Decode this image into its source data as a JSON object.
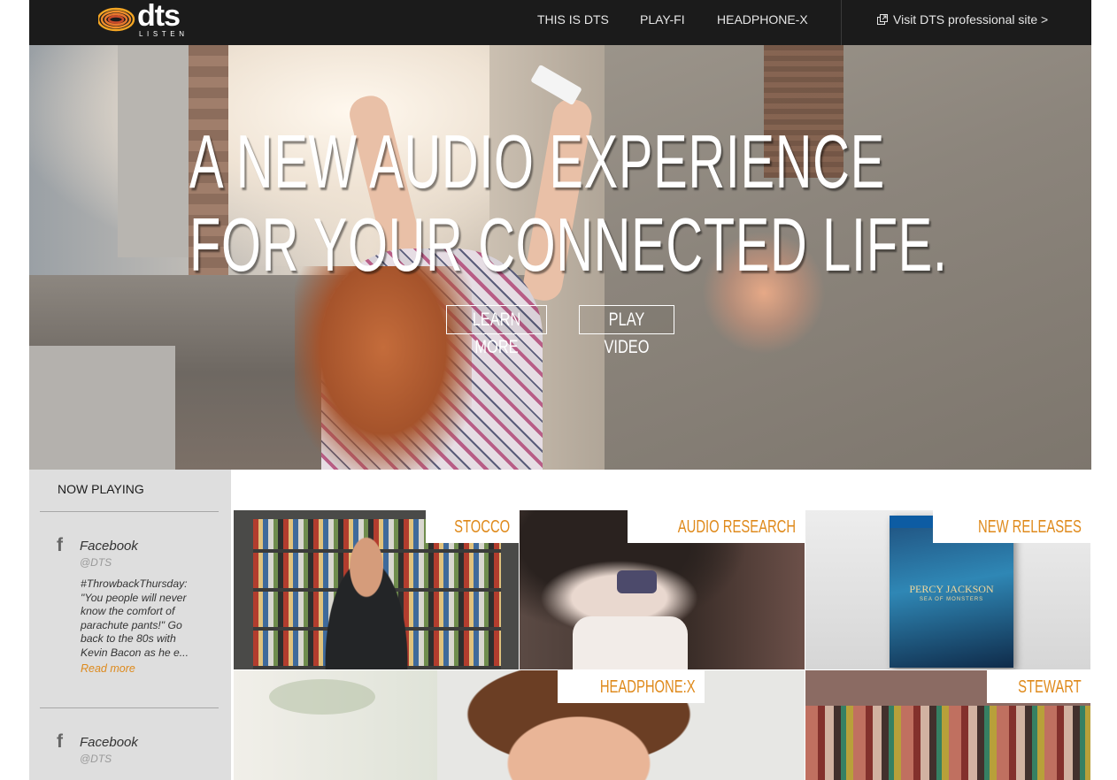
{
  "header": {
    "logo_text": "dts",
    "logo_sub": "LISTEN",
    "nav": [
      "THIS IS DTS",
      "PLAY-FI",
      "HEADPHONE-X"
    ],
    "pro_link": "Visit DTS professional site >",
    "colors": {
      "bar": "#1b1b1b",
      "text": "#e6e6e6",
      "logo_stripes": [
        "#f5a623",
        "#e8772e",
        "#c94b2a"
      ]
    }
  },
  "hero": {
    "title_line1": "A NEW AUDIO EXPERIENCE",
    "title_line2": "FOR YOUR CONNECTED LIFE.",
    "learn_more": "LEARN MORE",
    "play_video": "PLAY VIDEO"
  },
  "sidebar": {
    "title": "NOW PLAYING",
    "posts": [
      {
        "source": "Facebook",
        "handle": "@DTS",
        "icon": "facebook-icon",
        "body": "#ThrowbackThursday: \"You people will never know the comfort of parachute pants!\" Go back to the 80s with Kevin Bacon as he e...",
        "more": "Read more"
      },
      {
        "source": "Facebook",
        "handle": "@DTS",
        "icon": "facebook-icon"
      }
    ]
  },
  "tiles": [
    {
      "label": "STOCCO"
    },
    {
      "label": "AUDIO RESEARCH"
    },
    {
      "label": "NEW RELEASES",
      "cover_title": "PERCY JACKSON",
      "cover_sub": "SEA OF MONSTERS"
    },
    {
      "label": "HEADPHONE:X"
    },
    {
      "label": "STEWART"
    }
  ],
  "colors": {
    "accent": "#df8a1c",
    "sidebar_bg": "#dedede"
  }
}
